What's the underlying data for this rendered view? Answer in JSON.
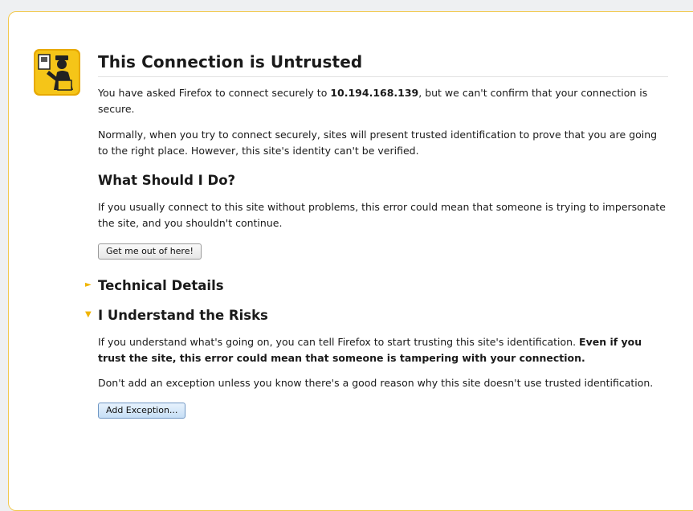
{
  "error_page": {
    "title": "This Connection is Untrusted",
    "intro_prefix": "You have asked Firefox to connect securely to ",
    "host": "10.194.168.139",
    "intro_suffix": ", but we can't confirm that your connection is secure.",
    "normally": "Normally, when you try to connect securely, sites will present trusted identification to prove that you are going to the right place. However, this site's identity can't be verified.",
    "what_heading": "What Should I Do?",
    "what_text": "If you usually connect to this site without problems, this error could mean that someone is trying to impersonate the site, and you shouldn't continue.",
    "get_out_label": "Get me out of here!",
    "technical_heading": "Technical Details",
    "risks_heading": "I Understand the Risks",
    "risks_text": "If you understand what's going on, you can tell Firefox to start trusting this site's identification. ",
    "risks_bold": "Even if you trust the site, this error could mean that someone is tampering with your connection.",
    "exception_text": "Don't add an exception unless you know there's a good reason why this site doesn't use trusted identification.",
    "add_exception_label": "Add Exception..."
  },
  "icons": {
    "header": "untrusted-connection-icon",
    "collapsed": "triangle-right-icon",
    "expanded": "triangle-down-icon"
  },
  "colors": {
    "page_border": "#f2c94c",
    "icon_background": "#f5c518",
    "arrow": "#f0b400"
  }
}
